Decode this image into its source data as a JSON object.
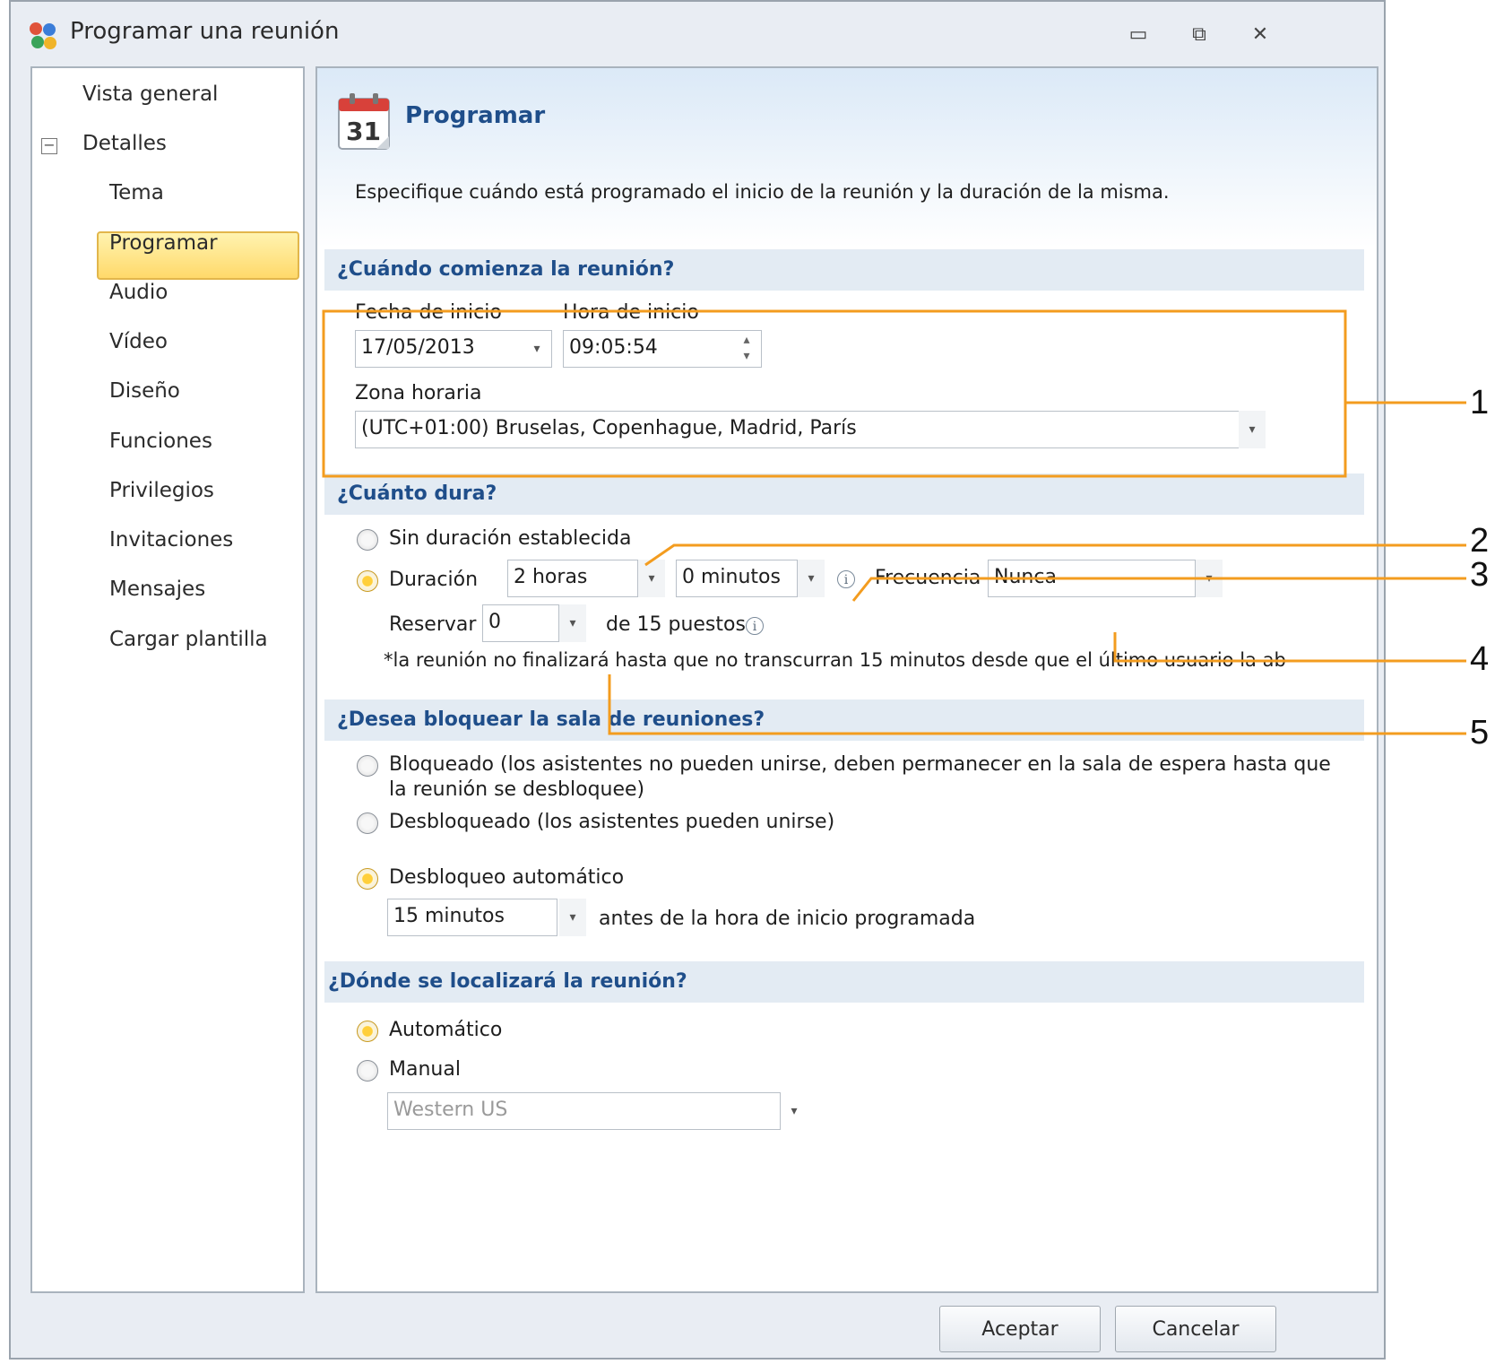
{
  "window": {
    "title": "Programar una reunión",
    "controls": {
      "minimize": "▭",
      "maximize": "⧉",
      "close": "✕"
    }
  },
  "sidebar": {
    "items": [
      {
        "label": "Vista general"
      },
      {
        "label": "Detalles"
      },
      {
        "label": "Tema"
      },
      {
        "label": "Programar"
      },
      {
        "label": "Audio"
      },
      {
        "label": "Vídeo"
      },
      {
        "label": "Diseño"
      },
      {
        "label": "Funciones"
      },
      {
        "label": "Privilegios"
      },
      {
        "label": "Invitaciones"
      },
      {
        "label": "Mensajes"
      },
      {
        "label": "Cargar plantilla"
      }
    ],
    "collapse_symbol": "−",
    "selected": "Programar"
  },
  "header": {
    "calendar_day": "31",
    "title": "Programar",
    "description": "Especifique cuándo está programado el inicio de la reunión y la duración de la misma."
  },
  "start": {
    "section_title": "¿Cuándo comienza la reunión?",
    "date_label": "Fecha de inicio",
    "date_value": "17/05/2013",
    "time_label": "Hora de inicio",
    "time_value": "09:05:54",
    "timezone_label": "Zona horaria",
    "timezone_value": "(UTC+01:00) Bruselas, Copenhague, Madrid, París"
  },
  "duration": {
    "section_title": "¿Cuánto dura?",
    "no_duration_label": "Sin duración establecida",
    "duration_label": "Duración",
    "hours_value": "2 horas",
    "minutes_value": "0 minutos",
    "frequency_label": "Frecuencia",
    "frequency_value": "Nunca",
    "reserve_label": "Reservar",
    "reserve_value": "0",
    "seats_text": "de 15 puestos",
    "note": "*la reunión no finalizará hasta que no transcurran 15 minutos desde que el último usuario la ab"
  },
  "lock": {
    "section_title": "¿Desea bloquear la sala de reuniones?",
    "locked_line1": "Bloqueado (los asistentes no pueden unirse, deben permanecer en la sala de espera hasta que",
    "locked_line2": "la reunión se desbloquee)",
    "unlocked_label": "Desbloqueado (los asistentes pueden unirse)",
    "auto_label": "Desbloqueo automático",
    "auto_value": "15 minutos",
    "auto_suffix": "antes de la hora de inicio programada"
  },
  "location": {
    "section_title": "¿Dónde se localizará la reunión?",
    "auto_label": "Automático",
    "manual_label": "Manual",
    "manual_value": "Western US"
  },
  "footer": {
    "ok_label": "Aceptar",
    "cancel_label": "Cancelar"
  },
  "callouts": [
    "1",
    "2",
    "3",
    "4",
    "5"
  ],
  "colors": {
    "accent_orange": "#f39c1f",
    "section_title_blue": "#1f4e8a",
    "selected_item": "#ffd96a"
  },
  "icons": {
    "dropdown": "▾",
    "spinner_up": "▴",
    "spinner_down": "▾",
    "info": "i"
  }
}
